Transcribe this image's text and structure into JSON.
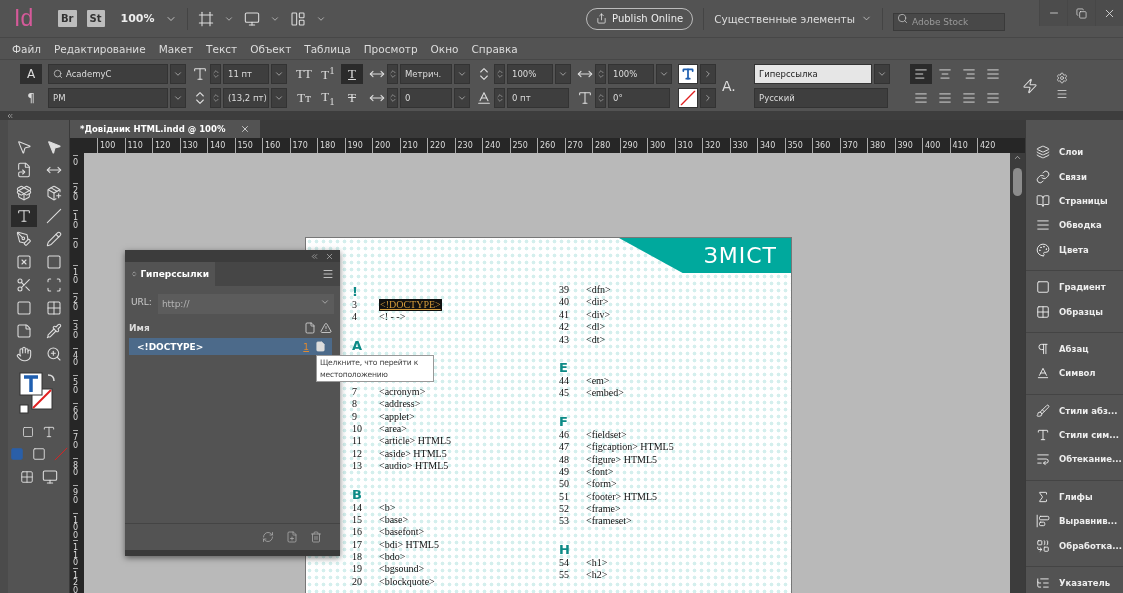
{
  "title_bar": {
    "app_logo": "Id",
    "bridge": "Br",
    "stock": "St",
    "zoom": "100%",
    "publish": "Publish Online",
    "workspace": "Существенные элементы",
    "search": {
      "placeholder": "Adobe Stock"
    }
  },
  "menu": [
    "Файл",
    "Редактирование",
    "Макет",
    "Текст",
    "Объект",
    "Таблица",
    "Просмотр",
    "Окно",
    "Справка"
  ],
  "control_panel": {
    "mode_buttons": [
      {
        "glyph": "A",
        "selected": true
      },
      {
        "glyph": "¶",
        "selected": false
      }
    ],
    "font_family": "AcademyC",
    "font_style": "PM",
    "font_size": "11 пт",
    "leading": "(13,2 пт)",
    "style_buttons": [
      {
        "glyph": "TT",
        "kind": "plain",
        "selected": false
      },
      {
        "glyph": "T$^{1}$",
        "kind": "plain",
        "selected": false
      },
      {
        "glyph": "T",
        "kind": "underline",
        "selected": true
      },
      {
        "glyph": "Tт",
        "kind": "plain",
        "selected": false
      },
      {
        "glyph": "T$_{1}$",
        "kind": "plain",
        "selected": false
      },
      {
        "glyph": "T",
        "kind": "strike",
        "selected": false
      }
    ],
    "kerning": "Метрич.",
    "tracking": "0",
    "vertical_scale": "100%",
    "baseline_shift": "0 пт",
    "horizontal_scale": "100%",
    "skew": "0°",
    "char_label": "A.",
    "char_style": "Гиперссылка",
    "language": "Русский",
    "align_buttons": [
      {
        "selected": true
      },
      {
        "selected": false
      },
      {
        "selected": false
      },
      {
        "selected": false
      },
      {
        "selected": false
      },
      {
        "selected": false
      },
      {
        "selected": false
      },
      {
        "selected": false
      }
    ]
  },
  "tools": [
    {
      "kind": "hollow-arrow",
      "selected": false
    },
    {
      "kind": "arrow",
      "selected": false
    },
    {
      "kind": "page",
      "selected": false
    },
    {
      "kind": "gap",
      "selected": false
    },
    {
      "kind": "collector",
      "selected": false
    },
    {
      "kind": "placer",
      "selected": false
    },
    {
      "kind": "type",
      "selected": true
    },
    {
      "kind": "line",
      "selected": false
    },
    {
      "kind": "pen",
      "selected": false
    },
    {
      "kind": "pencil",
      "selected": false
    },
    {
      "kind": "frame",
      "selected": false
    },
    {
      "kind": "rectangle",
      "selected": false
    },
    {
      "kind": "scissors",
      "selected": false
    },
    {
      "kind": "transform",
      "selected": false
    },
    {
      "kind": "gradient",
      "selected": false
    },
    {
      "kind": "feather",
      "selected": false
    },
    {
      "kind": "note",
      "selected": false
    },
    {
      "kind": "eyedropper",
      "selected": false
    },
    {
      "kind": "hand",
      "selected": false
    },
    {
      "kind": "zoom",
      "selected": false
    }
  ],
  "document_tab": "*Довідник HTML.indd @ 100%",
  "ruler_h": [
    "100",
    "110",
    "120",
    "130",
    "140",
    "150",
    "160",
    "170",
    "180",
    "190",
    "200",
    "210",
    "220",
    "230",
    "240",
    "250",
    "260",
    "270",
    "280",
    "290",
    "300",
    "310",
    "320",
    "330",
    "340",
    "350",
    "360",
    "370",
    "380",
    "390",
    "400",
    "410",
    "420"
  ],
  "ruler_v": [
    "0",
    "20",
    "10",
    "0",
    "10",
    "20",
    "30",
    "40",
    "50",
    "60",
    "70",
    "80",
    "90",
    "100",
    "110",
    "120"
  ],
  "page": {
    "heading": "ЗМІСТ",
    "columns": [
      [
        {
          "heading": "!",
          "entries": [
            {
              "num": "3",
              "tag": "<!DOCTYPE>",
              "highlighted": true
            },
            {
              "num": "4",
              "tag": "<! - ->",
              "highlighted": false
            }
          ]
        },
        {
          "heading": "A",
          "entries": [
            {
              "num": "7",
              "tag": "<acronym>",
              "highlighted": false
            },
            {
              "num": "8",
              "tag": "<address>",
              "highlighted": false
            },
            {
              "num": "9",
              "tag": "<applet>",
              "highlighted": false
            },
            {
              "num": "10",
              "tag": "<area>",
              "highlighted": false
            },
            {
              "num": "11",
              "tag": "<article> HTML5",
              "highlighted": false
            },
            {
              "num": "12",
              "tag": "<aside> HTML5",
              "highlighted": false
            },
            {
              "num": "13",
              "tag": "<audio> HTML5",
              "highlighted": false
            }
          ]
        },
        {
          "heading": "B",
          "entries": [
            {
              "num": "14",
              "tag": "<b>",
              "highlighted": false
            },
            {
              "num": "15",
              "tag": "<base>",
              "highlighted": false
            },
            {
              "num": "16",
              "tag": "<basefont>",
              "highlighted": false
            },
            {
              "num": "17",
              "tag": "<bdi> HTML5",
              "highlighted": false
            },
            {
              "num": "18",
              "tag": "<bdo>",
              "highlighted": false
            },
            {
              "num": "19",
              "tag": "<bgsound>",
              "highlighted": false
            },
            {
              "num": "20",
              "tag": "<blockquote>",
              "highlighted": false
            }
          ]
        }
      ],
      [
        {
          "entries": [
            {
              "num": "39",
              "tag": "<dfn>",
              "highlighted": false
            },
            {
              "num": "40",
              "tag": "<dir>",
              "highlighted": false
            },
            {
              "num": "41",
              "tag": "<div>",
              "highlighted": false
            },
            {
              "num": "42",
              "tag": "<dl>",
              "highlighted": false
            },
            {
              "num": "43",
              "tag": "<dt>",
              "highlighted": false
            }
          ]
        },
        {
          "heading": "E",
          "entries": [
            {
              "num": "44",
              "tag": "<em>",
              "highlighted": false
            },
            {
              "num": "45",
              "tag": "<embed>",
              "highlighted": false
            }
          ]
        },
        {
          "heading": "F",
          "entries": [
            {
              "num": "46",
              "tag": "<fieldset>",
              "highlighted": false
            },
            {
              "num": "47",
              "tag": "<figcaption> HTML5",
              "highlighted": false
            },
            {
              "num": "48",
              "tag": "<figure> HTML5",
              "highlighted": false
            },
            {
              "num": "49",
              "tag": "<font>",
              "highlighted": false
            },
            {
              "num": "50",
              "tag": "<form>",
              "highlighted": false
            },
            {
              "num": "51",
              "tag": "<footer> HTML5",
              "highlighted": false
            },
            {
              "num": "52",
              "tag": "<frame>",
              "highlighted": false
            },
            {
              "num": "53",
              "tag": "<frameset>",
              "highlighted": false
            }
          ]
        },
        {
          "heading": "H",
          "entries": [
            {
              "num": "54",
              "tag": "<h1>",
              "highlighted": false
            },
            {
              "num": "55",
              "tag": "<h2>",
              "highlighted": false
            }
          ]
        }
      ]
    ]
  },
  "hyperlinks_panel": {
    "title": "Гиперссылки",
    "url_label": "URL:",
    "url_placeholder": "http://",
    "name_column": "Имя",
    "rows": [
      {
        "name": "<!DOCTYPE>",
        "page": "1",
        "selected": true
      }
    ]
  },
  "tooltip": "Щелкните, что перейти к местоположению",
  "right_panel": [
    [
      {
        "kind": "layers",
        "label": "Слои"
      },
      {
        "kind": "links",
        "label": "Связи"
      },
      {
        "kind": "pages",
        "label": "Страницы"
      },
      {
        "kind": "stroke",
        "label": "Обводка"
      },
      {
        "kind": "color",
        "label": "Цвета"
      }
    ],
    [
      {
        "kind": "gradient",
        "label": "Градиент"
      },
      {
        "kind": "swatches",
        "label": "Образцы"
      }
    ],
    [
      {
        "kind": "paragraph",
        "label": "Абзац"
      },
      {
        "kind": "character",
        "label": "Символ"
      }
    ],
    [
      {
        "kind": "para-styles",
        "label": "Стили абз..."
      },
      {
        "kind": "char-styles",
        "label": "Стили сим..."
      },
      {
        "kind": "wrap",
        "label": "Обтекание..."
      }
    ],
    [
      {
        "kind": "glyphs",
        "label": "Глифы"
      },
      {
        "kind": "align",
        "label": "Выравнив..."
      },
      {
        "kind": "pathfinder",
        "label": "Обработка..."
      }
    ],
    [
      {
        "kind": "index",
        "label": "Указатель"
      }
    ]
  ]
}
